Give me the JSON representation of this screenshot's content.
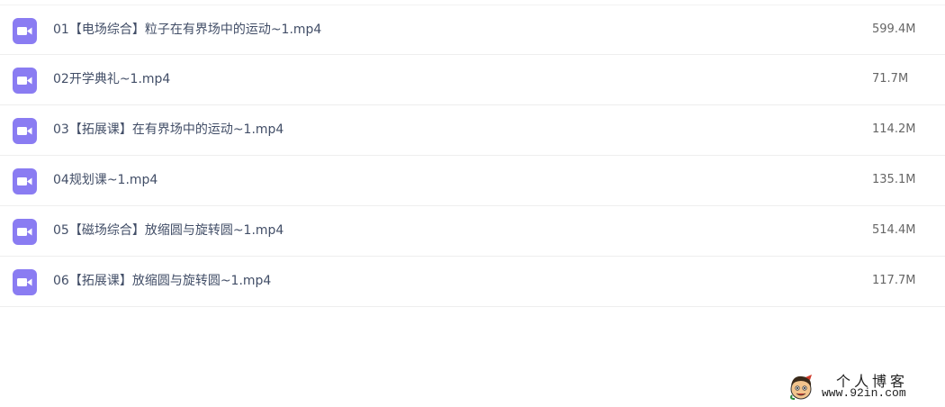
{
  "files": [
    {
      "name": "01【电场综合】粒子在有界场中的运动~1.mp4",
      "size": "599.4M",
      "icon": "video-file-icon"
    },
    {
      "name": "02开学典礼~1.mp4",
      "size": "71.7M",
      "icon": "video-file-icon"
    },
    {
      "name": "03【拓展课】在有界场中的运动~1.mp4",
      "size": "114.2M",
      "icon": "video-file-icon"
    },
    {
      "name": "04规划课~1.mp4",
      "size": "135.1M",
      "icon": "video-file-icon"
    },
    {
      "name": "05【磁场综合】放缩圆与旋转圆~1.mp4",
      "size": "514.4M",
      "icon": "video-file-icon"
    },
    {
      "name": "06【拓展课】放缩圆与旋转圆~1.mp4",
      "size": "117.7M",
      "icon": "video-file-icon"
    }
  ],
  "watermark": {
    "title": "个人博客",
    "url": "www.92in.com",
    "logo": "cartoon-face-logo"
  },
  "colors": {
    "icon_bg": "#8a7cf2",
    "file_name": "#424e67",
    "file_size": "#666666",
    "row_border": "#eeeeee"
  }
}
